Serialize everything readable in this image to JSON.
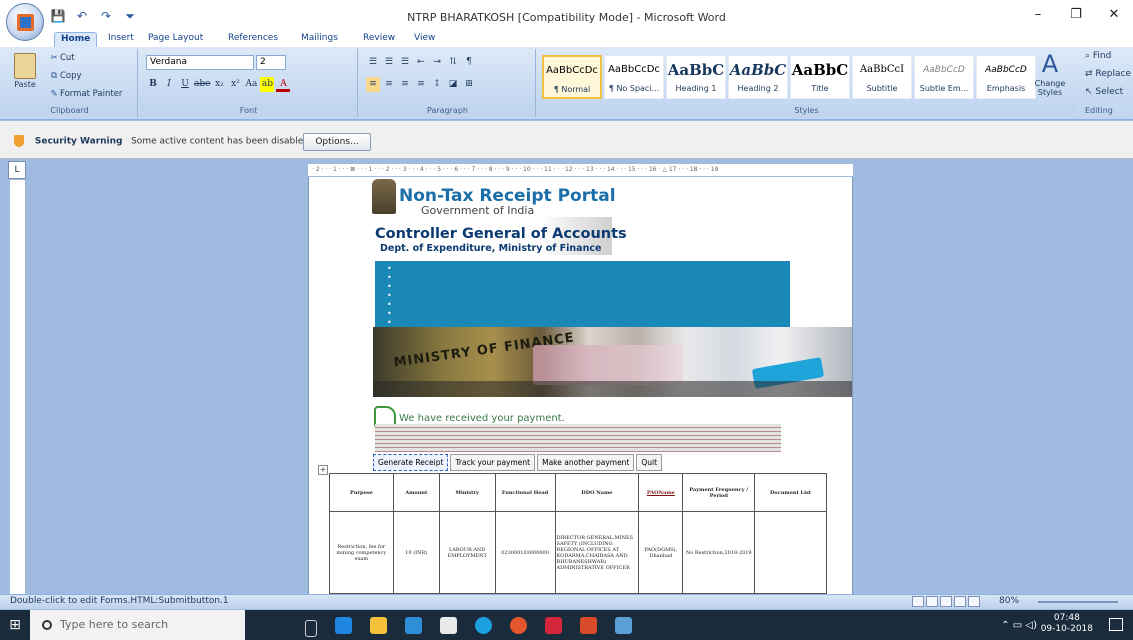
{
  "window": {
    "title": "NTRP BHARATKOSH [Compatibility Mode] - Microsoft Word",
    "controls": [
      "–",
      "❐",
      "✕"
    ]
  },
  "qat": [
    "💾",
    "↶",
    "↷",
    "⏷"
  ],
  "tabs": [
    "Home",
    "Insert",
    "Page Layout",
    "References",
    "Mailings",
    "Review",
    "View"
  ],
  "clipboard": {
    "paste": "Paste",
    "cut": "Cut",
    "copy": "Copy",
    "format_painter": "Format Painter",
    "label": "Clipboard"
  },
  "font": {
    "name": "Verdana",
    "size": "2",
    "label": "Font",
    "buttons": [
      "B",
      "I",
      "U",
      "abe",
      "x₂",
      "x²",
      "Aa",
      "ab",
      "A"
    ]
  },
  "paragraph": {
    "label": "Paragraph",
    "buttons": [
      "≡",
      "≡",
      "≡",
      "≡",
      "↕",
      "¶"
    ]
  },
  "styles": {
    "label": "Styles",
    "items": [
      {
        "preview": "AaBbCcDc",
        "name": "¶ Normal"
      },
      {
        "preview": "AaBbCcDc",
        "name": "¶ No Spaci..."
      },
      {
        "preview": "AaBbC",
        "name": "Heading 1"
      },
      {
        "preview": "AaBbC",
        "name": "Heading 2"
      },
      {
        "preview": "AaBbC",
        "name": "Title"
      },
      {
        "preview": "AaBbCcI",
        "name": "Subtitle"
      },
      {
        "preview": "AaBbCcD",
        "name": "Subtle Em..."
      },
      {
        "preview": "AaBbCcD",
        "name": "Emphasis"
      }
    ],
    "change_styles": "Change Styles"
  },
  "editing": {
    "find": "Find",
    "replace": "Replace",
    "select": "Select",
    "label": "Editing"
  },
  "security": {
    "title": "Security Warning",
    "message": "Some active content has been disabled.",
    "options": "Options..."
  },
  "ruler": "· 2 · · · 1 · · · ⊠ · · · 1 · · · 2 · · · 3 · · · 4 · · · 5 · · · 6 · · · 7 · · · 8 · · · 9 · · · 10 · · · 11 · · · 12 · · · 13 · · · 14 · · · 15 · · · 16 · △ 17 · · · 18 · · · 19",
  "document": {
    "portal_title": "Non-Tax Receipt Portal",
    "government": "Government of India",
    "cga": "Controller General of Accounts",
    "dept": "Dept. of Expenditure, Ministry of Finance",
    "banner_text": "MINISTRY OF FINANCE",
    "received": "We have received your payment.",
    "buttons": [
      "Generate Receipt",
      "Track your payment",
      "Make another payment",
      "Quit"
    ],
    "table": {
      "headers": [
        "Purpose",
        "Amount",
        "Ministry",
        "Functional Head",
        "DDO Name",
        "PAOName",
        "Payment Frequency / Period",
        "Document List"
      ],
      "rows": [
        [
          "Restriction, fee for mining competency exam",
          "10 (INR)",
          "LABOUR AND EMPLOYMENT",
          "023000103000000",
          "DIRECTOR GENERAL,MINES SAFETY (INCLUDING REGIONAL OFFICES AT KODARMA,CHAIBASA AND BHUBANESHWAR) ADMINISTRATIVE OFFICER",
          "PAO(DGMS), Dhanbad",
          "No Restriction,2018-2019",
          ""
        ]
      ]
    }
  },
  "status": {
    "text": "Double-click to edit Forms.HTML:Submitbutton.1",
    "zoom": "80%"
  },
  "taskbar": {
    "search_placeholder": "Type here to search",
    "time": "07:48",
    "date": "09-10-2018"
  },
  "colors": {
    "accent_blue": "#1b89b8",
    "ribbon": "#c6d9f1",
    "title_blue": "#1a6fa8"
  }
}
